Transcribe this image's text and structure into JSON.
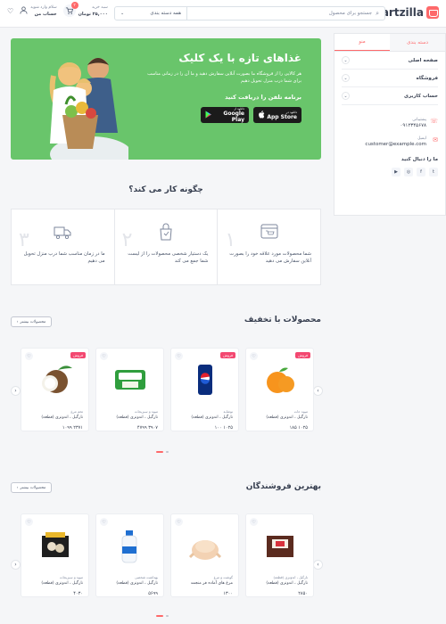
{
  "header": {
    "logo_text": "Cartzilla",
    "search_placeholder": "جستجو برای محصول",
    "category_select": "همه دسته بندی",
    "account_hello": "سلام وارد شوید",
    "account_label": "حساب من",
    "cart_label": "سبد خرید",
    "cart_total": "۲۵,۰۰۰ تومان",
    "cart_count": "۳"
  },
  "sidebar": {
    "tabs": [
      "دسته بندی",
      "منو"
    ],
    "items": [
      {
        "label": "صفحه اصلی"
      },
      {
        "label": "فروشگاه"
      },
      {
        "label": "حساب کاربری"
      }
    ],
    "support_label": "پشتیبانی",
    "support_phone": "۰۹۱۲۳۴۵۶۷۸",
    "email_label": "ایمیل",
    "email_value": "customer@example.com",
    "follow_label": "ما را دنبال کنید",
    "socials": [
      "twitter-icon",
      "facebook-icon",
      "instagram-icon",
      "youtube-icon"
    ]
  },
  "hero": {
    "title": "غذاهای تازه با یک کلیک",
    "desc": "هر کالایی را از فروشگاه ما بصورت آنلاین سفارش دهید و ما آن را در زمانی مناسب برای شما درب منزل تحویل دهیم",
    "app_title": "برنامه تلفن را دریافت کنید",
    "appstore_small": "دانلود در",
    "appstore_big": "App Store",
    "googleplay_small": "دانلود از",
    "googleplay_big": "Google Play",
    "bg_color": "#69c56b"
  },
  "how": {
    "title": "چگونه کار می کند؟",
    "steps": [
      {
        "num": "۱",
        "text": "شما محصولات مورد علاقه خود را بصورت آنلاین سفارش می دهید"
      },
      {
        "num": "۲",
        "text": "یک دستیار شخصی محصولات را از لیست شما جمع می کند"
      },
      {
        "num": "۳",
        "text": "ما در زمان مناسب شما درب منزل تحویل می دهیم"
      }
    ]
  },
  "discount": {
    "title": "محصولات با تخفیف",
    "more": "محصولات بیشتر",
    "products": [
      {
        "badge": "فروش",
        "category": "میوه جات",
        "name": "نارگیل ، اندونزی (قطعه)",
        "price": "۱۰۲۵ ۱۸۵",
        "image": "orange"
      },
      {
        "badge": "فروش",
        "category": "نوشابه",
        "name": "نارگیل ، اندونزی (قطعه)",
        "price": "۱۰۲۵ ۱۰۰",
        "image": "pepsi"
      },
      {
        "badge": "",
        "category": "میوه و سبزیجات",
        "name": "نارگیل ، اندونزی (قطعه)",
        "price": "۳۹۰۷ ۴۷۹۹",
        "image": "cheese"
      },
      {
        "badge": "فروش",
        "category": "تخم مرغ",
        "name": "نارگیل ، اندونزی (قطعه)",
        "price": "۲۳۷۱ ۱۰۹۹",
        "image": "coconut"
      }
    ]
  },
  "best": {
    "title": "بهترین فروشندگان",
    "more": "محصولات بیشتر",
    "products": [
      {
        "category": "نارگیل ، اندونزی (قطعه)",
        "name": "نارگیل ، اندونزی (قطعه)",
        "price": "۲۸۵۰",
        "image": "chocolate"
      },
      {
        "category": "گوشت و مرغ",
        "name": "مرغ های آماده فر منجمد",
        "price": "۱۳۰۰",
        "image": "chicken"
      },
      {
        "category": "بهداشت شخصی",
        "name": "نارگیل ، اندونزی (قطعه)",
        "price": "۵۶۹۹",
        "image": "shampoo"
      },
      {
        "category": "میوه و سبزیجات",
        "name": "نارگیل ، اندونزی (قطعه)",
        "price": "۴۰۳۰",
        "image": "mushroom"
      }
    ]
  },
  "colors": {
    "accent": "#fe696a",
    "hero": "#69c56b",
    "sale": "#f34770"
  }
}
